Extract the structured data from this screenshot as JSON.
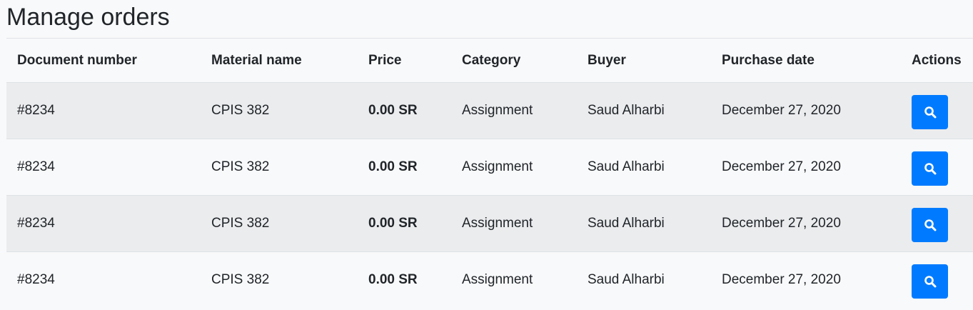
{
  "page": {
    "title": "Manage orders"
  },
  "table": {
    "headers": {
      "document_number": "Document number",
      "material_name": "Material name",
      "price": "Price",
      "category": "Category",
      "buyer": "Buyer",
      "purchase_date": "Purchase date",
      "actions": "Actions"
    },
    "rows": [
      {
        "document_number": "#8234",
        "material_name": "CPIS 382",
        "price": "0.00 SR",
        "category": "Assignment",
        "buyer": "Saud Alharbi",
        "purchase_date": "December 27, 2020",
        "action_icon": "search-icon"
      },
      {
        "document_number": "#8234",
        "material_name": "CPIS 382",
        "price": "0.00 SR",
        "category": "Assignment",
        "buyer": "Saud Alharbi",
        "purchase_date": "December 27, 2020",
        "action_icon": "search-icon"
      },
      {
        "document_number": "#8234",
        "material_name": "CPIS 382",
        "price": "0.00 SR",
        "category": "Assignment",
        "buyer": "Saud Alharbi",
        "purchase_date": "December 27, 2020",
        "action_icon": "search-icon"
      },
      {
        "document_number": "#8234",
        "material_name": "CPIS 382",
        "price": "0.00 SR",
        "category": "Assignment",
        "buyer": "Saud Alharbi",
        "purchase_date": "December 27, 2020",
        "action_icon": "search-icon"
      }
    ]
  },
  "colors": {
    "primary": "#007bff",
    "stripe": "#ebecee",
    "background": "#f8f9fa",
    "text": "#212529"
  }
}
